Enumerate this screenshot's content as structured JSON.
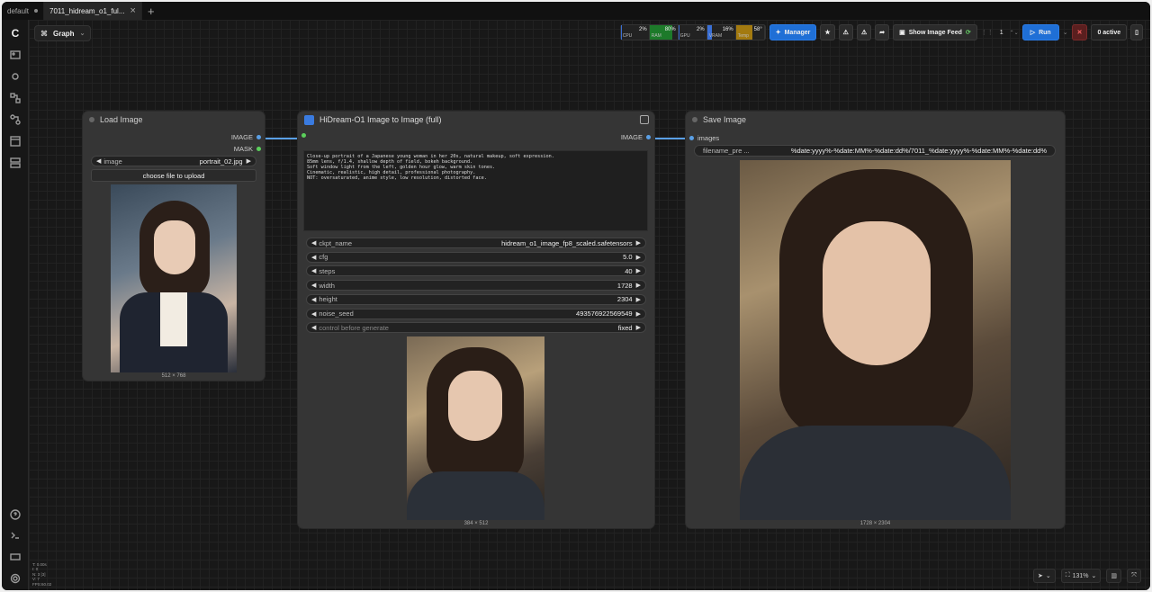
{
  "tabs": [
    {
      "label": "default"
    },
    {
      "label": "7011_hidream_o1_ful..."
    }
  ],
  "graph_label": "Graph",
  "monitors": [
    {
      "label": "CPU",
      "value": "2%",
      "color": "#3a6fd6",
      "level": 0.02
    },
    {
      "label": "RAM",
      "value": "80%",
      "color": "#1d7a2a",
      "level": 0.8
    },
    {
      "label": "GPU",
      "value": "2%",
      "color": "#3a6fd6",
      "level": 0.02
    },
    {
      "label": "VRAM",
      "value": "16%",
      "color": "#3a6fd6",
      "level": 0.16
    },
    {
      "label": "Temp",
      "value": "58°",
      "color": "#a37a10",
      "level": 0.58
    }
  ],
  "toolbar": {
    "manager": "Manager",
    "show_feed": "Show Image Feed",
    "queue_count": "1",
    "run": "Run",
    "active": "0 active"
  },
  "load_node": {
    "title": "Load Image",
    "outputs": [
      "IMAGE",
      "MASK"
    ],
    "widget_label": "image",
    "widget_value": "portrait_02.jpg",
    "upload": "choose file to upload",
    "caption": "512 × 768"
  },
  "hidream_node": {
    "title": "HiDream-O1 Image to Image (full)",
    "output": "IMAGE",
    "prompt": "Close-up portrait of a Japanese young woman in her 20s, natural makeup, soft expression.\n85mm lens, f/1.4, shallow depth of field, bokeh background.\nSoft window light from the left, golden hour glow, warm skin tones.\nCinematic, realistic, high detail, professional photography.\nNOT: oversaturated, anime style, low resolution, distorted face.",
    "widgets": [
      {
        "label": "ckpt_name",
        "value": "hidream_o1_image_fp8_scaled.safetensors"
      },
      {
        "label": "cfg",
        "value": "5.0"
      },
      {
        "label": "steps",
        "value": "40"
      },
      {
        "label": "width",
        "value": "1728"
      },
      {
        "label": "height",
        "value": "2304"
      },
      {
        "label": "noise_seed",
        "value": "493576922569549"
      },
      {
        "label": "control before generate",
        "value": "fixed"
      }
    ],
    "caption": "384 × 512"
  },
  "save_node": {
    "title": "Save Image",
    "input": "images",
    "filename_label": "filename_pre ...",
    "filename_value": "%date:yyyy%-%date:MM%-%date:dd%/7011_%date:yyyy%-%date:MM%-%date:dd%",
    "caption": "1728 × 2304"
  },
  "zoom": "131%",
  "stats": "T: 0.00s\nI: 0\nN: 3 [3]\nV: 7\nFPS:60.02"
}
